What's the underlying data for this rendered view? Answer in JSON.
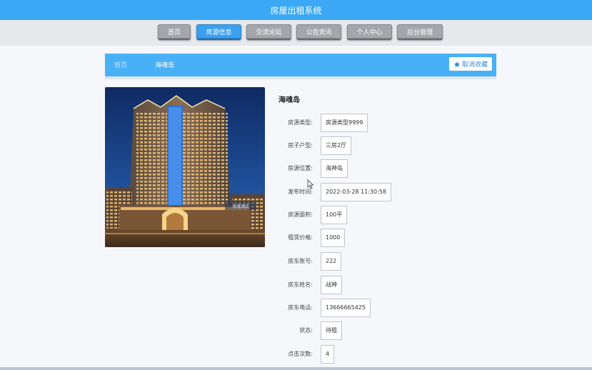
{
  "app": {
    "title": "房屋出租系统"
  },
  "nav": {
    "items": [
      {
        "label": "首页"
      },
      {
        "label": "房源信息"
      },
      {
        "label": "交流论坛"
      },
      {
        "label": "公告资讯"
      },
      {
        "label": "个人中心"
      },
      {
        "label": "后台管理"
      }
    ],
    "active_index": 1
  },
  "breadcrumb": {
    "home": "首页",
    "current": "海魂岛"
  },
  "favorite": {
    "label": "取消收藏",
    "icon": "star-icon"
  },
  "photo": {
    "sign_text": "海魂酒店"
  },
  "detail": {
    "title": "海魂岛",
    "fields": [
      {
        "label": "房源类型:",
        "value": "房源类型9999"
      },
      {
        "label": "房子户型:",
        "value": "三房2厅"
      },
      {
        "label": "房源位置:",
        "value": "海神岛"
      },
      {
        "label": "发布时间:",
        "value": "2022-03-28 11:30:58"
      },
      {
        "label": "房源面积:",
        "value": "100平"
      },
      {
        "label": "租赁价格:",
        "value": "1000"
      },
      {
        "label": "房东账号:",
        "value": "222"
      },
      {
        "label": "房东姓名:",
        "value": "战神"
      },
      {
        "label": "房东电话:",
        "value": "13666665425"
      },
      {
        "label": "状态:",
        "value": "待租"
      },
      {
        "label": "点击次数:",
        "value": "4"
      }
    ]
  },
  "colors": {
    "primary": "#3ba8f5",
    "nav_inactive": "#a4a6ab",
    "breadcrumb_bg": "#48b0f6"
  }
}
